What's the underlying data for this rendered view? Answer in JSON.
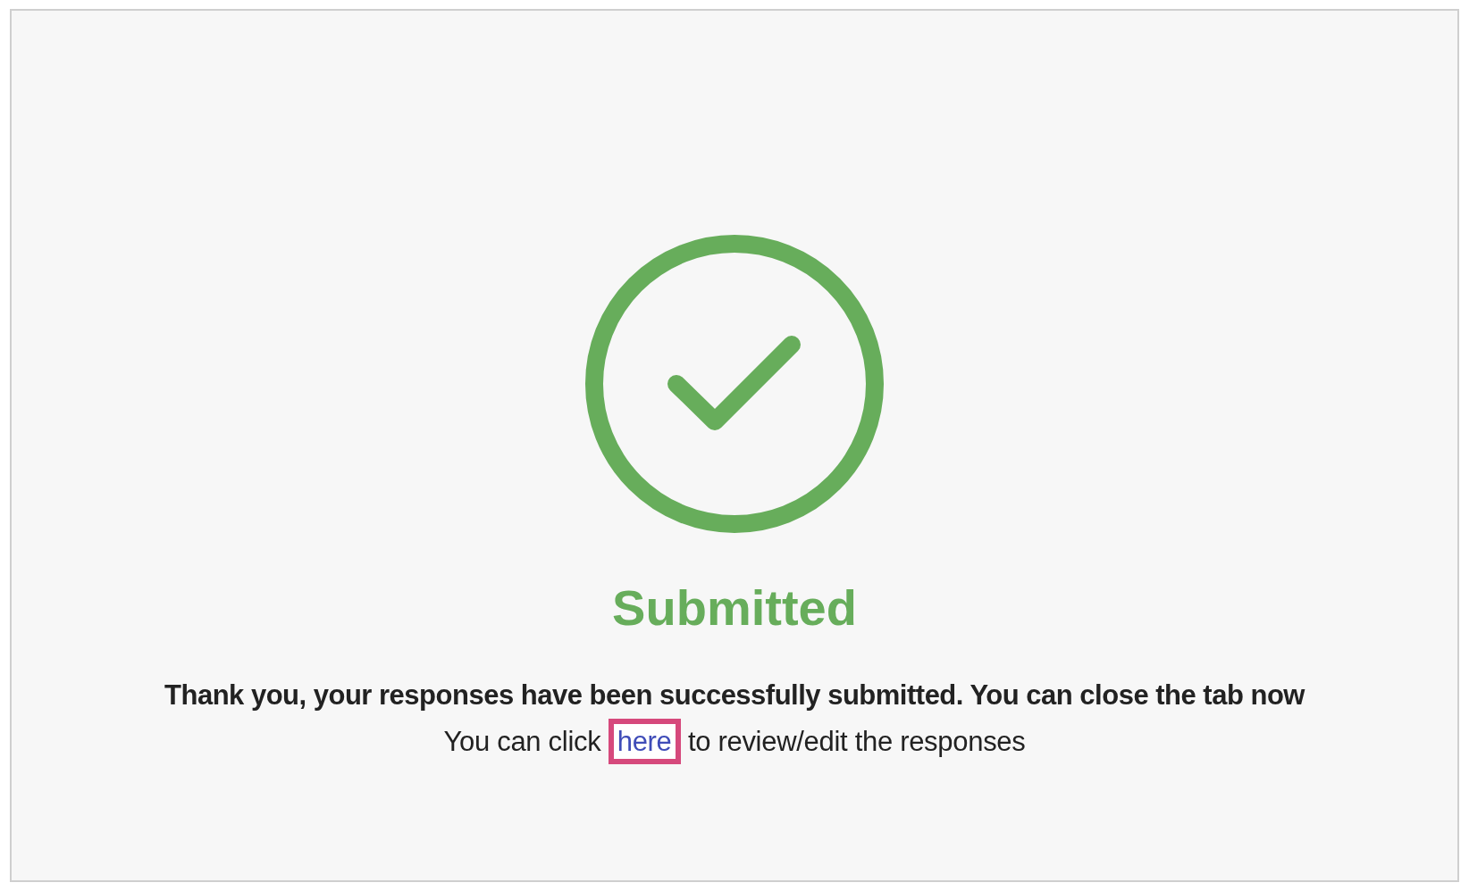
{
  "status": {
    "title": "Submitted"
  },
  "message": "Thank you, your responses have been successfully submitted. You can close the tab now",
  "review": {
    "before": "You can click",
    "link": "here",
    "after": "to review/edit the responses",
    "highlighted": true
  }
}
